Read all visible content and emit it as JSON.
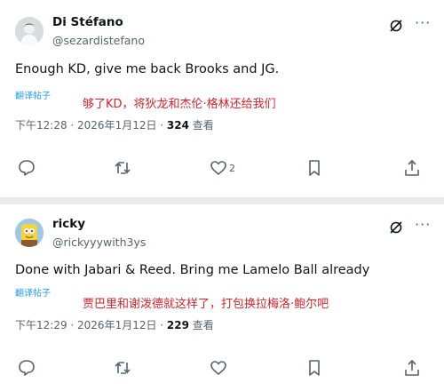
{
  "tweets": [
    {
      "name": "Di Stéfano",
      "handle": "@sezardistefano",
      "text": "Enough KD, give me back Brooks and JG.",
      "translate_label": "翻译帖子",
      "annotation": "够了KD，将狄龙和杰伦·格林还给我们",
      "time": "下午12:28 · 2026年1月12日 · ",
      "views": "324",
      "views_label": " 查看",
      "likes": "2"
    },
    {
      "name": "ricky",
      "handle": "@rickyyywith3ys",
      "text": "Done with Jabari & Reed. Bring me Lamelo Ball already",
      "translate_label": "翻译帖子",
      "annotation": "贾巴里和谢泼德就这样了，打包换拉梅洛·鲍尔吧",
      "time": "下午12:29 · 2026年1月12日 · ",
      "views": "229",
      "views_label": " 查看",
      "likes": ""
    }
  ],
  "icons": {
    "grok": "grok-icon",
    "more": "more-icon",
    "reply": "reply-icon",
    "repost": "repost-icon",
    "like": "like-icon",
    "bookmark": "bookmark-icon",
    "share": "share-icon"
  },
  "colors": {
    "text": "#0f1419",
    "secondary": "#536471",
    "link": "#1d9bf0",
    "annotation": "#d4232b",
    "separator": "#e9ebee"
  }
}
